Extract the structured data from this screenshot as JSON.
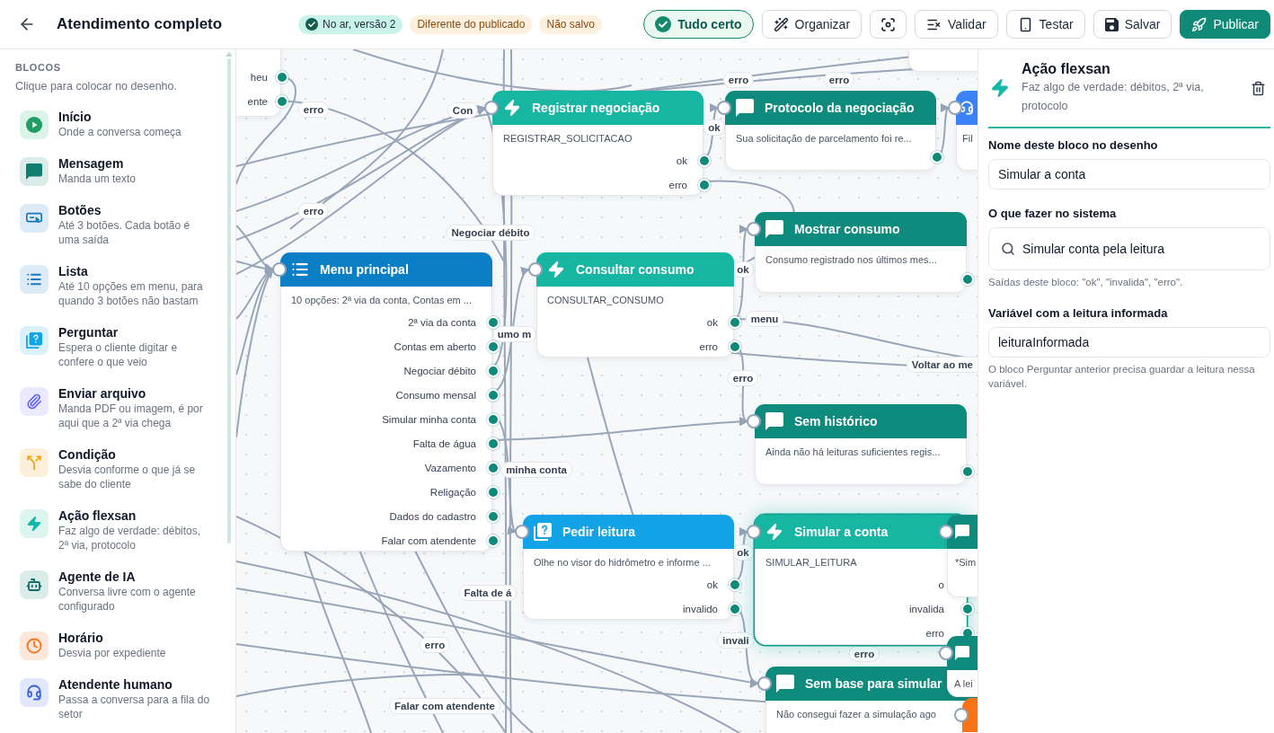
{
  "header": {
    "title": "Atendimento completo",
    "badges": [
      {
        "kind": "live",
        "label": "No ar, versão 2"
      },
      {
        "kind": "warning",
        "label": "Diferente do publicado"
      },
      {
        "kind": "warning",
        "label": "Não salvo"
      }
    ],
    "actions": [
      {
        "kind": "status",
        "label": "Tudo certo"
      },
      {
        "kind": "organize",
        "label": "Organizar"
      },
      {
        "kind": "focus"
      },
      {
        "kind": "validate",
        "label": "Validar"
      },
      {
        "kind": "test",
        "label": "Testar"
      },
      {
        "kind": "save",
        "label": "Salvar"
      },
      {
        "kind": "publish",
        "label": "Publicar"
      }
    ]
  },
  "sidebar": {
    "title": "BLOCOS",
    "hint": "Clique para colocar no desenho.",
    "items": [
      {
        "kind": "start",
        "title": "Início",
        "description": "Onde a conversa começa"
      },
      {
        "kind": "message",
        "title": "Mensagem",
        "description": "Manda um texto"
      },
      {
        "kind": "buttons",
        "title": "Botões",
        "description": "Até 3 botões. Cada botão é uma saída"
      },
      {
        "kind": "list",
        "title": "Lista",
        "description": "Até 10 opções em menu, para quando 3 botões não bastam"
      },
      {
        "kind": "question",
        "title": "Perguntar",
        "description": "Espera o cliente digitar e confere o que veio"
      },
      {
        "kind": "file",
        "title": "Enviar arquivo",
        "description": "Manda PDF ou imagem, é por aqui que a 2ª via chega"
      },
      {
        "kind": "condition",
        "title": "Condição",
        "description": "Desvia conforme o que já se sabe do cliente"
      },
      {
        "kind": "action",
        "title": "Ação flexsan",
        "description": "Faz algo de verdade: débitos, 2ª via, protocolo"
      },
      {
        "kind": "agent",
        "title": "Agente de IA",
        "description": "Conversa livre com o agente configurado"
      },
      {
        "kind": "schedule",
        "title": "Horário",
        "description": "Desvia por expediente"
      },
      {
        "kind": "human",
        "title": "Atendente humano",
        "description": "Passa a conversa para a fila do setor"
      }
    ]
  },
  "canvas": {
    "nodes": [
      {
        "kind": "blank",
        "outputs": [
          "heu",
          "ente"
        ],
        "selected": false
      },
      {
        "kind": "blank",
        "selected": false
      },
      {
        "kind": "action",
        "title": "Registrar negociação",
        "body": "REGISTRAR_SOLICITACAO",
        "outputs": [
          "ok",
          "erro"
        ],
        "selected": false
      },
      {
        "kind": "message",
        "title": "Protocolo da negociação",
        "body": "Sua solicitação de parcelamento foi re...",
        "selected": false
      },
      {
        "kind": "human",
        "body": "Fil",
        "selected": false
      },
      {
        "kind": "message",
        "title": "Mostrar consumo",
        "body": "Consumo registrado nos últimos mes...",
        "selected": false
      },
      {
        "kind": "list",
        "title": "Menu principal",
        "body": "10 opções: 2ª via da conta, Contas em ...",
        "outputs": [
          "2ª via da conta",
          "Contas em aberto",
          "Negociar débito",
          "Consumo mensal",
          "Simular minha conta",
          "Falta de água",
          "Vazamento",
          "Religação",
          "Dados do cadastro",
          "Falar com atendente"
        ],
        "selected": false
      },
      {
        "kind": "action",
        "title": "Consultar consumo",
        "body": "CONSULTAR_CONSUMO",
        "outputs": [
          "ok",
          "erro"
        ],
        "selected": false
      },
      {
        "kind": "message",
        "title": "Sem histórico",
        "body": "Ainda não há leituras suficientes regis...",
        "selected": false
      },
      {
        "kind": "question",
        "title": "Pedir leitura",
        "body": "Olhe no visor do hidrômetro e informe ...",
        "outputs": [
          "ok",
          "invalido"
        ],
        "selected": false
      },
      {
        "kind": "action",
        "title": "Simular a conta",
        "body": "SIMULAR_LEITURA",
        "outputs": [
          "o",
          "invalida",
          "erro"
        ],
        "selected": true
      },
      {
        "kind": "message",
        "body": "*Sim",
        "selected": false
      },
      {
        "kind": "message",
        "body": "A lei",
        "selected": false
      },
      {
        "kind": "message",
        "title": "Sem base para simular",
        "body": "Não consegui fazer a simulação ago",
        "selected": false
      },
      {
        "kind": "schedule",
        "selected": false
      }
    ],
    "edge_labels": [
      "erro",
      "erro",
      "erro",
      "Con",
      "ok",
      "erro",
      "Negociar débito",
      "ok",
      "menu",
      "umo m",
      "Voltar ao me",
      "erro",
      "minha conta",
      "ok",
      "Falta de á",
      "invali",
      "erro",
      "erro",
      "Falar com atendente"
    ]
  },
  "inspector": {
    "kind": "action",
    "title": "Ação flexsan",
    "description": "Faz algo de verdade: débitos, 2ª via, protocolo",
    "fields": [
      {
        "kind": "text",
        "label": "Nome deste bloco no desenho",
        "value": "Simular a conta"
      },
      {
        "kind": "search",
        "label": "O que fazer no sistema",
        "value": "Simular conta pela leitura",
        "hint": "Saídas deste bloco: \"ok\", \"invalida\", \"erro\"."
      },
      {
        "kind": "text",
        "label": "Variável com a leitura informada",
        "value": "leituraInformada",
        "hint": "O bloco Perguntar anterior precisa guardar a leitura nessa variável."
      }
    ]
  }
}
